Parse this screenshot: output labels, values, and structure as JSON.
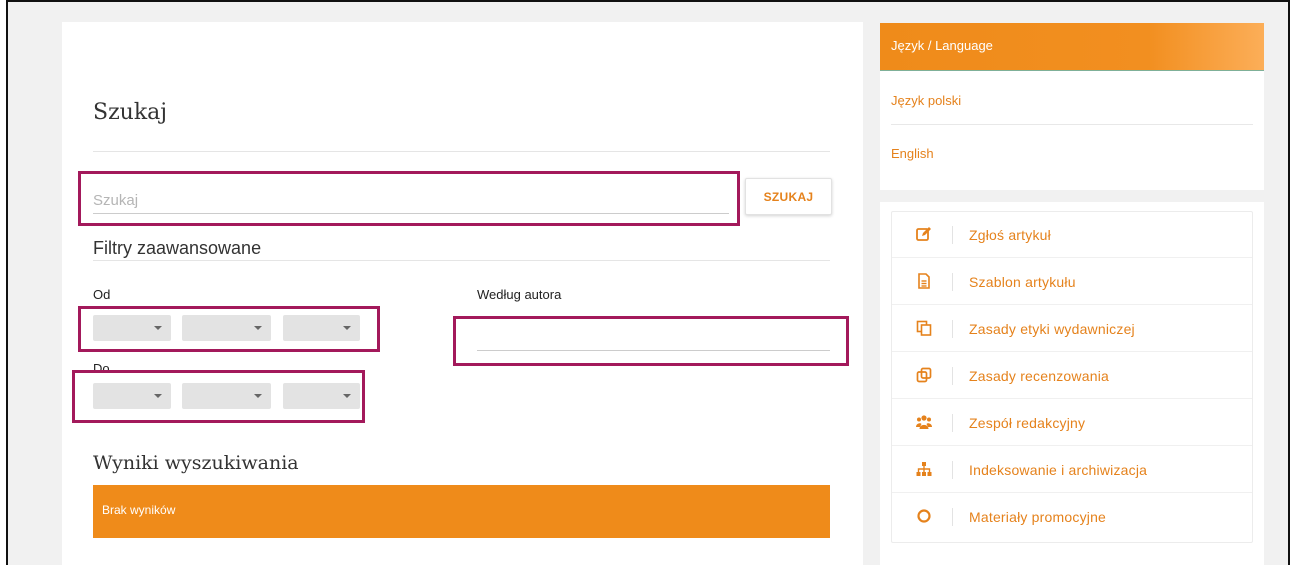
{
  "search": {
    "title": "Szukaj",
    "placeholder": "Szukaj",
    "button_label": "SZUKAJ"
  },
  "filters": {
    "title": "Filtry zaawansowane",
    "from_label": "Od",
    "to_label": "Do",
    "author_label": "Według autora",
    "author_value": ""
  },
  "results": {
    "title": "Wyniki wyszukiwania",
    "empty_message": "Brak wyników"
  },
  "language": {
    "header": "Język / Language",
    "options": [
      "Język polski",
      "English"
    ]
  },
  "sidebar_menu": [
    {
      "label": "Zgłoś artykuł",
      "icon": "edit-icon"
    },
    {
      "label": "Szablon artykułu",
      "icon": "document-icon"
    },
    {
      "label": "Zasady etyki wydawniczej",
      "icon": "copy-icon"
    },
    {
      "label": "Zasady recenzowania",
      "icon": "clone-icon"
    },
    {
      "label": "Zespół redakcyjny",
      "icon": "users-icon"
    },
    {
      "label": "Indeksowanie i archiwizacja",
      "icon": "sitemap-icon"
    },
    {
      "label": "Materiały promocyjne",
      "icon": "circle-icon"
    }
  ],
  "colors": {
    "accent": "#ef8b1a",
    "link": "#e5821c",
    "highlight_box": "#a3195b"
  }
}
